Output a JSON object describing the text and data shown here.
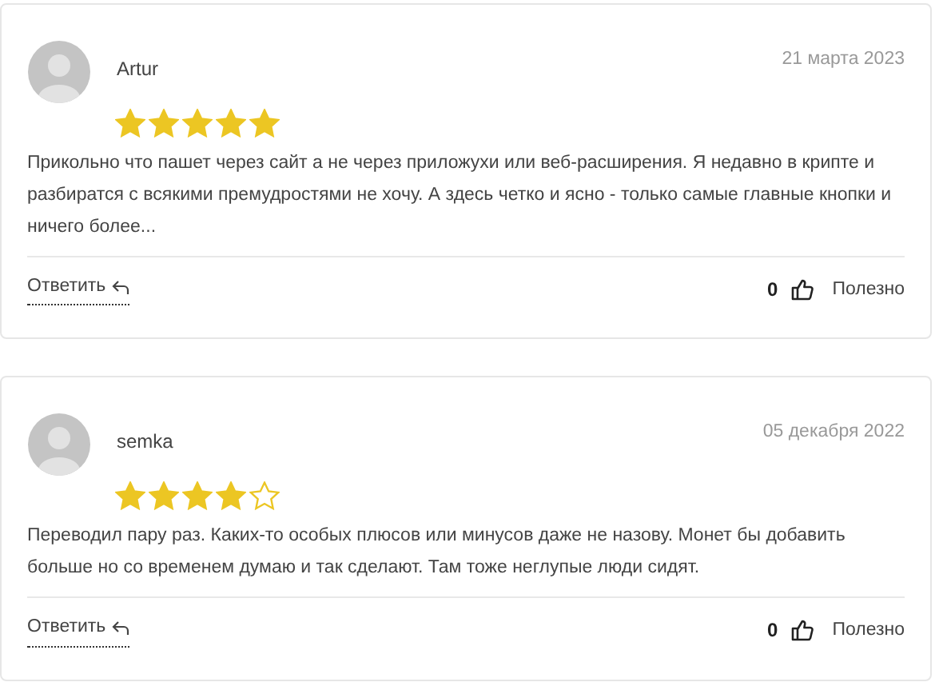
{
  "reviews": [
    {
      "author": "Artur",
      "date": "21 марта 2023",
      "stars": 5,
      "text": "Прикольно что пашет через сайт а не через приложухи или веб-расширения. Я недавно в крипте и разбиратся с всякими премудростями не хочу. А здесь четко и ясно - только самые главные кнопки и ничего более...",
      "reply": "Ответить",
      "likes": "0",
      "useful": "Полезно"
    },
    {
      "author": "semka",
      "date": "05 декабря 2022",
      "stars": 4,
      "text": "Переводил пару раз. Каких-то особых плюсов или минусов даже не назову. Монет бы добавить больше но со временем думаю и так сделают. Там тоже неглупые люди сидят.",
      "reply": "Ответить",
      "likes": "0",
      "useful": "Полезно"
    }
  ]
}
